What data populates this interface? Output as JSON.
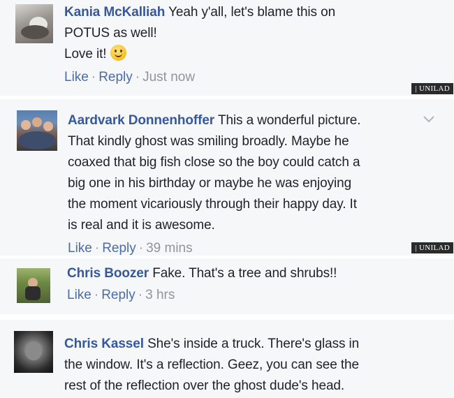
{
  "comments": [
    {
      "author": "Kania McKalliah",
      "lines": [
        "Yeah y'all, let's blame this on",
        "POTUS as well!",
        "Love it!"
      ],
      "emoji": "smiley-icon",
      "actions": {
        "like": "Like",
        "reply": "Reply",
        "time": "Just now"
      },
      "watermark": "| UNILAD"
    },
    {
      "author": "Aardvark Donnenhoffer",
      "lines": [
        "This a wonderful picture.",
        "That kindly ghost was smiling broadly. Maybe he",
        "coaxed that big fish close so the boy could catch a",
        "big one in his birthday or maybe he was enjoying",
        "the moment vicariously through their happy day. It",
        "is real and it is awesome."
      ],
      "actions": {
        "like": "Like",
        "reply": "Reply",
        "time": "39 mins"
      },
      "watermark": "| UNILAD"
    },
    {
      "author": "Chris Boozer",
      "lines": [
        "Fake. That's a tree and shrubs!!"
      ],
      "actions": {
        "like": "Like",
        "reply": "Reply",
        "time": "3 hrs"
      }
    },
    {
      "author": "Chris Kassel",
      "lines": [
        "She's inside a truck. There's glass in",
        "the window. It's a reflection. Geez, you can see the",
        "rest of the reflection over the ghost dude's head."
      ]
    }
  ],
  "actions_separator": "·",
  "colors": {
    "link": "#365899",
    "meta": "#90949c",
    "panel": "#f6f7f9"
  }
}
